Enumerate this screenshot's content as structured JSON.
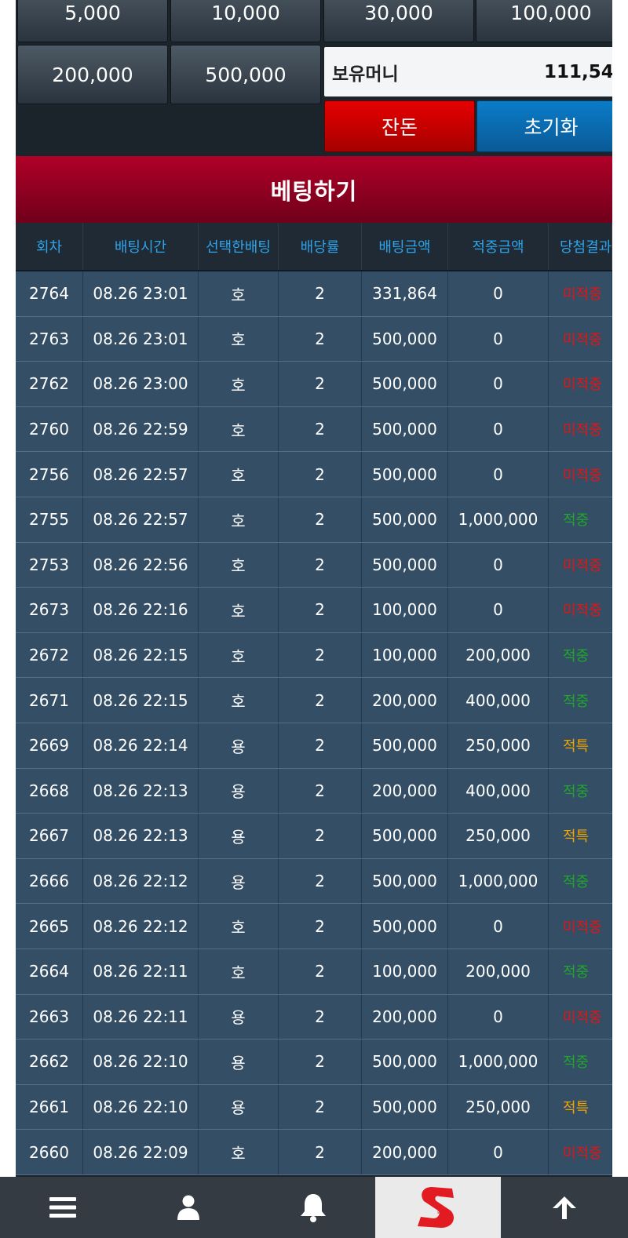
{
  "chips": [
    "5,000",
    "10,000",
    "30,000",
    "100,000",
    "200,000",
    "500,000"
  ],
  "balance": {
    "label": "보유머니",
    "value": "111,54"
  },
  "buttons": {
    "remaining": "잔돈",
    "reset": "초기화"
  },
  "bet_button": "베팅하기",
  "table": {
    "headers": [
      "회차",
      "배팅시간",
      "선택한배팅",
      "배당률",
      "배팅금액",
      "적중금액",
      "당첨결과"
    ],
    "rows": [
      {
        "round": "2764",
        "time": "08.26 23:01",
        "choice": "호",
        "odds": "2",
        "bet": "331,864",
        "win": "0",
        "result": "미적중",
        "status": "lose"
      },
      {
        "round": "2763",
        "time": "08.26 23:01",
        "choice": "호",
        "odds": "2",
        "bet": "500,000",
        "win": "0",
        "result": "미적중",
        "status": "lose"
      },
      {
        "round": "2762",
        "time": "08.26 23:00",
        "choice": "호",
        "odds": "2",
        "bet": "500,000",
        "win": "0",
        "result": "미적중",
        "status": "lose"
      },
      {
        "round": "2760",
        "time": "08.26 22:59",
        "choice": "호",
        "odds": "2",
        "bet": "500,000",
        "win": "0",
        "result": "미적중",
        "status": "lose"
      },
      {
        "round": "2756",
        "time": "08.26 22:57",
        "choice": "호",
        "odds": "2",
        "bet": "500,000",
        "win": "0",
        "result": "미적중",
        "status": "lose"
      },
      {
        "round": "2755",
        "time": "08.26 22:57",
        "choice": "호",
        "odds": "2",
        "bet": "500,000",
        "win": "1,000,000",
        "result": "적중",
        "status": "win"
      },
      {
        "round": "2753",
        "time": "08.26 22:56",
        "choice": "호",
        "odds": "2",
        "bet": "500,000",
        "win": "0",
        "result": "미적중",
        "status": "lose"
      },
      {
        "round": "2673",
        "time": "08.26 22:16",
        "choice": "호",
        "odds": "2",
        "bet": "100,000",
        "win": "0",
        "result": "미적중",
        "status": "lose"
      },
      {
        "round": "2672",
        "time": "08.26 22:15",
        "choice": "호",
        "odds": "2",
        "bet": "100,000",
        "win": "200,000",
        "result": "적중",
        "status": "win"
      },
      {
        "round": "2671",
        "time": "08.26 22:15",
        "choice": "호",
        "odds": "2",
        "bet": "200,000",
        "win": "400,000",
        "result": "적중",
        "status": "win"
      },
      {
        "round": "2669",
        "time": "08.26 22:14",
        "choice": "용",
        "odds": "2",
        "bet": "500,000",
        "win": "250,000",
        "result": "적특",
        "status": "spec"
      },
      {
        "round": "2668",
        "time": "08.26 22:13",
        "choice": "용",
        "odds": "2",
        "bet": "200,000",
        "win": "400,000",
        "result": "적중",
        "status": "win"
      },
      {
        "round": "2667",
        "time": "08.26 22:13",
        "choice": "용",
        "odds": "2",
        "bet": "500,000",
        "win": "250,000",
        "result": "적특",
        "status": "spec"
      },
      {
        "round": "2666",
        "time": "08.26 22:12",
        "choice": "용",
        "odds": "2",
        "bet": "500,000",
        "win": "1,000,000",
        "result": "적중",
        "status": "win"
      },
      {
        "round": "2665",
        "time": "08.26 22:12",
        "choice": "호",
        "odds": "2",
        "bet": "500,000",
        "win": "0",
        "result": "미적중",
        "status": "lose"
      },
      {
        "round": "2664",
        "time": "08.26 22:11",
        "choice": "호",
        "odds": "2",
        "bet": "100,000",
        "win": "200,000",
        "result": "적중",
        "status": "win"
      },
      {
        "round": "2663",
        "time": "08.26 22:11",
        "choice": "용",
        "odds": "2",
        "bet": "200,000",
        "win": "0",
        "result": "미적중",
        "status": "lose"
      },
      {
        "round": "2662",
        "time": "08.26 22:10",
        "choice": "용",
        "odds": "2",
        "bet": "500,000",
        "win": "1,000,000",
        "result": "적중",
        "status": "win"
      },
      {
        "round": "2661",
        "time": "08.26 22:10",
        "choice": "용",
        "odds": "2",
        "bet": "500,000",
        "win": "250,000",
        "result": "적특",
        "status": "spec"
      },
      {
        "round": "2660",
        "time": "08.26 22:09",
        "choice": "호",
        "odds": "2",
        "bet": "200,000",
        "win": "0",
        "result": "미적중",
        "status": "lose"
      }
    ]
  },
  "nav": {
    "items": [
      "menu-icon",
      "user-icon",
      "bell-icon",
      "brand-logo",
      "arrow-up-icon"
    ],
    "logo_letter": "S"
  },
  "colors": {
    "lose": "#e51414",
    "win": "#1fa82a",
    "spec": "#f0a500",
    "accent": "#2fa3e8"
  }
}
